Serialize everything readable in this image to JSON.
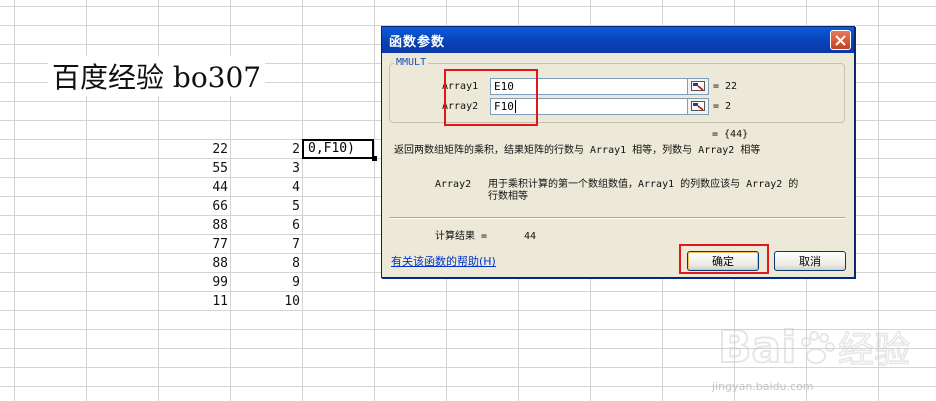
{
  "sheet": {
    "title": "百度经验 bo307",
    "colE": [
      "22",
      "55",
      "44",
      "66",
      "88",
      "77",
      "88",
      "99",
      "11"
    ],
    "colF": [
      "2",
      "3",
      "4",
      "5",
      "6",
      "7",
      "8",
      "9",
      "10"
    ],
    "active_cell_text": "0,F10)"
  },
  "dialog": {
    "title": "函数参数",
    "function_name": "MMULT",
    "args": [
      {
        "label": "Array1",
        "value": "E10",
        "result": "= 22"
      },
      {
        "label": "Array2",
        "value": "F10",
        "result": "= 2"
      }
    ],
    "overall_result": "= {44}",
    "description": "返回两数组矩阵的乘积，结果矩阵的行数与 Array1 相等，列数与 Array2 相等",
    "param_name": "Array2",
    "param_desc_line1": "用于乘积计算的第一个数组数值，Array1 的列数应该与 Array2 的",
    "param_desc_line2": "行数相等",
    "calc_label": "计算结果 =",
    "calc_value": "44",
    "help_link": "有关该函数的帮助(H)",
    "ok_label": "确定",
    "cancel_label": "取消"
  },
  "watermark": {
    "text": "Bai 经验",
    "sub": "jingyan.baidu.com"
  },
  "colors": {
    "titlebar": "#0842b8",
    "highlight": "#e0181c",
    "dialog_bg": "#ece9d8"
  }
}
